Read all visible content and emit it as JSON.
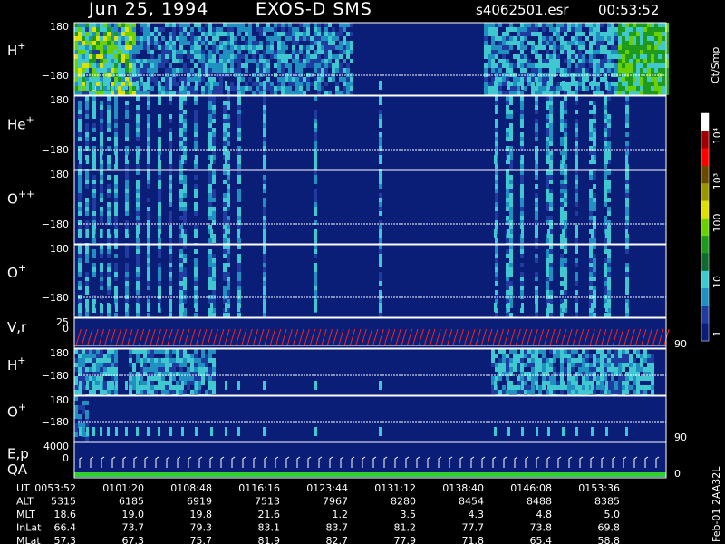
{
  "header": {
    "date": "Jun 25, 1994",
    "mission": "EXOS-D SMS",
    "file": "s4062501.esr",
    "time": "00:53:52"
  },
  "colorbar": {
    "unit": "Ct/Smp",
    "tick_labels": [
      "10⁴",
      "10³",
      "100",
      "10",
      "1"
    ],
    "colors": [
      "#ffffff",
      "#a00000",
      "#ff0000",
      "#6b4a00",
      "#9a9400",
      "#e0e000",
      "#6ad000",
      "#1e9a1e",
      "#0f6a30",
      "#40c8d0",
      "#2090c0",
      "#203ca0",
      "#0a1e78"
    ]
  },
  "footer": {
    "side_note": "Feb-01 2AA32L",
    "rows": [
      {
        "label": "UT",
        "values": [
          "0053:52",
          "0101:20",
          "0108:48",
          "0116:16",
          "0123:44",
          "0131:12",
          "0138:40",
          "0146:08",
          "0153:36"
        ]
      },
      {
        "label": "ALT",
        "values": [
          "5315",
          "6185",
          "6919",
          "7513",
          "7967",
          "8280",
          "8454",
          "8488",
          "8385"
        ]
      },
      {
        "label": "MLT",
        "values": [
          "18.6",
          "19.0",
          "19.8",
          "21.6",
          "1.2",
          "3.5",
          "4.3",
          "4.8",
          "5.0"
        ]
      },
      {
        "label": "InLat",
        "values": [
          "66.4",
          "73.7",
          "79.3",
          "83.1",
          "83.7",
          "81.2",
          "77.7",
          "73.8",
          "69.8"
        ]
      },
      {
        "label": "MLat",
        "values": [
          "57.3",
          "67.3",
          "75.7",
          "81.9",
          "82.7",
          "77.9",
          "71.8",
          "65.4",
          "58.8"
        ]
      }
    ]
  },
  "chart_data": {
    "type": "heatmap",
    "title": "Jun 25, 1994   EXOS-D SMS",
    "x_ticks": [
      "0053:52",
      "0101:20",
      "0108:48",
      "0116:16",
      "0123:44",
      "0131:12",
      "0138:40",
      "0146:08",
      "0153:36"
    ],
    "colorscale": {
      "unit": "Ct/Smp",
      "range": [
        1,
        10000
      ],
      "scale": "log"
    },
    "panels": [
      {
        "label": "H",
        "sup": "+",
        "ymax": "180",
        "ymin": "−180",
        "kind": "spectrogram",
        "activity": "high"
      },
      {
        "label": "He",
        "sup": "+",
        "ymax": "180",
        "ymin": "−180",
        "kind": "spectrogram",
        "activity": "low"
      },
      {
        "label": "O",
        "sup": "++",
        "ymax": "180",
        "ymin": "−180",
        "kind": "spectrogram",
        "activity": "low"
      },
      {
        "label": "O",
        "sup": "+",
        "ymax": "180",
        "ymin": "−180",
        "kind": "spectrogram",
        "activity": "low"
      },
      {
        "label": "V,r",
        "sup": "",
        "ymax": "25",
        "ymin": "0",
        "right_label": "90",
        "kind": "sawtooth"
      },
      {
        "label": "H",
        "sup": "+",
        "ymax": "180",
        "ymin": "−180",
        "kind": "spectrogram",
        "activity": "mid"
      },
      {
        "label": "O",
        "sup": "+",
        "ymax": "180",
        "ymin": "−180",
        "right_label": "90",
        "kind": "spectrogram",
        "activity": "very_low"
      },
      {
        "label": "E,p",
        "sup": "",
        "label2": "QA",
        "ymax": "4000",
        "ymin": "0",
        "right_label": "0",
        "kind": "steps"
      }
    ]
  }
}
